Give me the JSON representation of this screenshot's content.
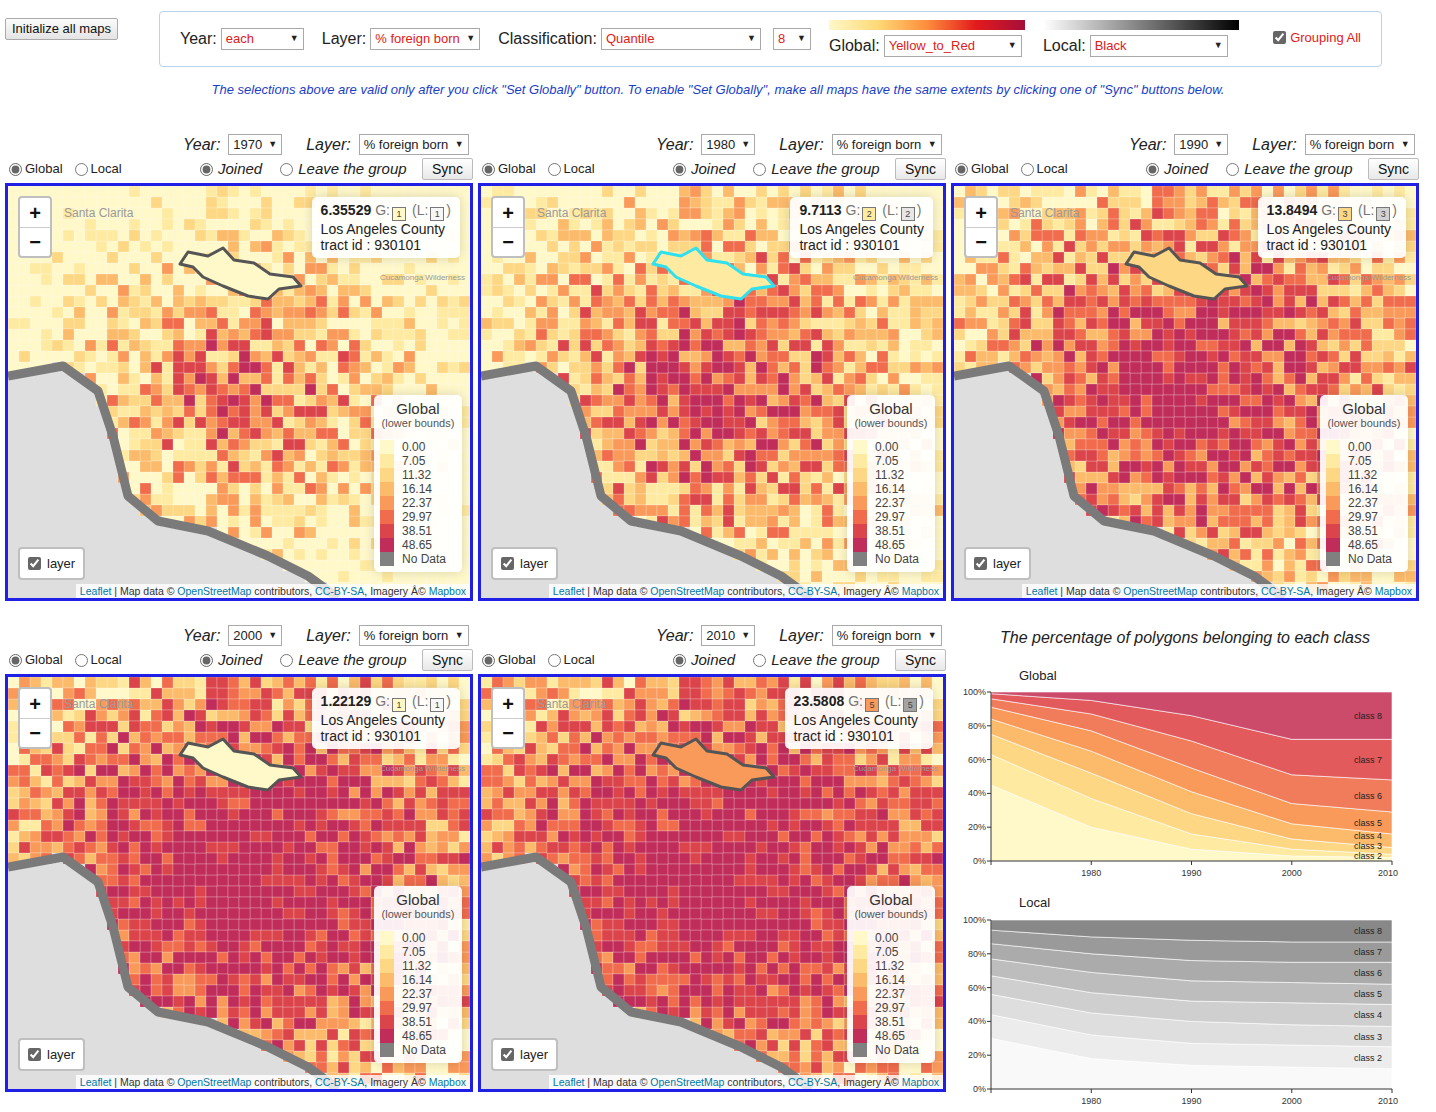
{
  "arrow": "▼",
  "toolbar": {
    "init_button": "Initialize all maps",
    "year": {
      "label": "Year:",
      "value": "each"
    },
    "layer": {
      "label": "Layer:",
      "value": "% foreign born"
    },
    "classification": {
      "label": "Classification:",
      "value": "Quantile"
    },
    "classes": {
      "value": "8"
    },
    "global": {
      "label": "Global:",
      "value": "Yellow_to_Red",
      "ramp": [
        "#fff8c8",
        "#fed976",
        "#fd8d3c",
        "#e31a1c",
        "#a50f3a"
      ]
    },
    "local": {
      "label": "Local:",
      "value": "Black",
      "ramp": [
        "#ffffff",
        "#000000"
      ]
    },
    "grouping": {
      "label": "Grouping All",
      "checked": true
    }
  },
  "note": "The selections above are valid only after you click \"Set Globally\" button. To enable \"Set Globally\", make all maps have the same extents by clicking one of \"Sync\" buttons below.",
  "map_common": {
    "year_label": "Year:",
    "layer_label": "Layer:",
    "zoom_in": "+",
    "zoom_out": "−",
    "place_labels": [
      "Santa Clarita",
      "Cucamonga Wilderness"
    ],
    "legend": {
      "title": "Global",
      "subtitle": "(lower bounds)",
      "items": [
        {
          "label": "0.00",
          "color": "#fff8c8"
        },
        {
          "label": "7.05",
          "color": "#feeaa0"
        },
        {
          "label": "11.32",
          "color": "#fdd783"
        },
        {
          "label": "16.14",
          "color": "#fcbb6b"
        },
        {
          "label": "22.37",
          "color": "#fa9a5a"
        },
        {
          "label": "29.97",
          "color": "#f06c4c"
        },
        {
          "label": "38.51",
          "color": "#db444b"
        },
        {
          "label": "48.65",
          "color": "#c02d5a"
        },
        {
          "label": "No Data",
          "color": "#808080"
        }
      ]
    },
    "attribution": [
      {
        "text": "Leaflet",
        "link": true
      },
      {
        "text": " | Map data © ",
        "link": false
      },
      {
        "text": "OpenStreetMap",
        "link": true
      },
      {
        "text": " contributors, ",
        "link": false
      },
      {
        "text": "CC-BY-SA",
        "link": true
      },
      {
        "text": ", Imagery Â© ",
        "link": false
      },
      {
        "text": "Mapbox",
        "link": true
      }
    ]
  },
  "maps": [
    {
      "year": "1970",
      "layer": "% foreign born",
      "scope": [
        {
          "label": "Global",
          "selected": true
        },
        {
          "label": "Local",
          "selected": false
        }
      ],
      "group": [
        {
          "label": "Joined",
          "selected": true
        },
        {
          "label": "Leave the group",
          "selected": false
        }
      ],
      "sync": "Sync",
      "info": {
        "value": "6.35529",
        "g_label": "G:",
        "g_class": "1",
        "g_color": "#fff8c8",
        "l_label": "(L:",
        "l_class": "1",
        "l_color": "#f7f7f7",
        "l_close": ")",
        "county": "Los Angeles County",
        "tract": "tract id : 930101"
      },
      "tract": {
        "fill": "#fff8c8",
        "outline": "#555555"
      },
      "layer_toggle": {
        "label": "layer",
        "checked": true
      }
    },
    {
      "year": "1980",
      "layer": "% foreign born",
      "scope": [
        {
          "label": "Global",
          "selected": true
        },
        {
          "label": "Local",
          "selected": false
        }
      ],
      "group": [
        {
          "label": "Joined",
          "selected": true
        },
        {
          "label": "Leave the group",
          "selected": false
        }
      ],
      "sync": "Sync",
      "info": {
        "value": "9.7113",
        "g_label": "G:",
        "g_class": "2",
        "g_color": "#feeaa0",
        "l_label": "(L:",
        "l_class": "2",
        "l_color": "#e6e6e6",
        "l_close": ")",
        "county": "Los Angeles County",
        "tract": "tract id : 930101"
      },
      "tract": {
        "fill": "#feeaa0",
        "outline": "#2fe0ee"
      },
      "layer_toggle": {
        "label": "layer",
        "checked": true
      }
    },
    {
      "year": "1990",
      "layer": "% foreign born",
      "scope": [
        {
          "label": "Global",
          "selected": true
        },
        {
          "label": "Local",
          "selected": false
        }
      ],
      "group": [
        {
          "label": "Joined",
          "selected": true
        },
        {
          "label": "Leave the group",
          "selected": false
        }
      ],
      "sync": "Sync",
      "info": {
        "value": "13.8494",
        "g_label": "G:",
        "g_class": "3",
        "g_color": "#fdd783",
        "l_label": "(L:",
        "l_class": "3",
        "l_color": "#d2d2d2",
        "l_close": ")",
        "county": "Los Angeles County",
        "tract": "tract id : 930101"
      },
      "tract": {
        "fill": "#fdd783",
        "outline": "#555555"
      },
      "layer_toggle": {
        "label": "layer",
        "checked": true
      }
    },
    {
      "year": "2000",
      "layer": "% foreign born",
      "scope": [
        {
          "label": "Global",
          "selected": true
        },
        {
          "label": "Local",
          "selected": false
        }
      ],
      "group": [
        {
          "label": "Joined",
          "selected": true
        },
        {
          "label": "Leave the group",
          "selected": false
        }
      ],
      "sync": "Sync",
      "info": {
        "value": "1.22129",
        "g_label": "G:",
        "g_class": "1",
        "g_color": "#fff8c8",
        "l_label": "(L:",
        "l_class": "1",
        "l_color": "#f7f7f7",
        "l_close": ")",
        "county": "Los Angeles County",
        "tract": "tract id : 930101"
      },
      "tract": {
        "fill": "#fff8c8",
        "outline": "#555555"
      },
      "layer_toggle": {
        "label": "layer",
        "checked": true
      }
    },
    {
      "year": "2010",
      "layer": "% foreign born",
      "scope": [
        {
          "label": "Global",
          "selected": true
        },
        {
          "label": "Local",
          "selected": false
        }
      ],
      "group": [
        {
          "label": "Joined",
          "selected": true
        },
        {
          "label": "Leave the group",
          "selected": false
        }
      ],
      "sync": "Sync",
      "info": {
        "value": "23.5808",
        "g_label": "G:",
        "g_class": "5",
        "g_color": "#fa9a5a",
        "l_label": "(L:",
        "l_class": "5",
        "l_color": "#a3a3a3",
        "l_close": ")",
        "county": "Los Angeles County",
        "tract": "tract id : 930101"
      },
      "tract": {
        "fill": "#fa9a5a",
        "outline": "#555555"
      },
      "layer_toggle": {
        "label": "layer",
        "checked": true
      }
    }
  ],
  "chart": {
    "title": "The percentage of polygons belonging to each class",
    "panels": [
      {
        "title": "Global",
        "y_ticks": [
          "0%",
          "20%",
          "40%",
          "60%",
          "80%",
          "100%"
        ],
        "x_ticks": [
          "1980",
          "1990",
          "2000",
          "2010"
        ],
        "series": [
          {
            "label": null,
            "color": "#fff8c8",
            "values": [
              45,
              20,
              7,
              3,
              2
            ]
          },
          {
            "label": "class 2",
            "color": "#feeaa0",
            "values": [
              18,
              17,
              9,
              4,
              2
            ]
          },
          {
            "label": "class 3",
            "color": "#fdd783",
            "values": [
              12,
              15,
              12,
              6,
              4
            ]
          },
          {
            "label": "class 4",
            "color": "#fcbb6b",
            "values": [
              9,
              13,
              13,
              9,
              8
            ]
          },
          {
            "label": "class 5",
            "color": "#fa9a5a",
            "values": [
              7,
              12,
              14,
              12,
              13
            ]
          },
          {
            "label": "class 6",
            "color": "#f07c5c",
            "values": [
              5,
              10,
              16,
              17,
              19
            ]
          },
          {
            "label": "class 7",
            "color": "#e25a5c",
            "values": [
              3,
              8,
              15,
              21,
              24
            ]
          },
          {
            "label": "class 8",
            "color": "#cc4a6a",
            "values": [
              1,
              5,
              14,
              28,
              28
            ]
          }
        ]
      },
      {
        "title": "Local",
        "y_ticks": [
          "0%",
          "20%",
          "40%",
          "60%",
          "80%",
          "100%"
        ],
        "x_ticks": [
          "1980",
          "1990",
          "2000",
          "2010"
        ],
        "series": [
          {
            "label": null,
            "color": "#f9f9f9",
            "values": [
              30,
              18,
              14,
              13,
              12
            ]
          },
          {
            "label": "class 2",
            "color": "#ececec",
            "values": [
              14,
              14,
              13,
              13,
              13
            ]
          },
          {
            "label": "class 3",
            "color": "#dedede",
            "values": [
              12,
              13,
              13,
              12,
              12
            ]
          },
          {
            "label": "class 4",
            "color": "#cfcfcf",
            "values": [
              11,
              12,
              12,
              13,
              13
            ]
          },
          {
            "label": "class 5",
            "color": "#bdbdbd",
            "values": [
              10,
              12,
              12,
              12,
              12
            ]
          },
          {
            "label": "class 6",
            "color": "#ababab",
            "values": [
              9,
              11,
              12,
              12,
              13
            ]
          },
          {
            "label": "class 7",
            "color": "#9a9a9a",
            "values": [
              8,
              10,
              12,
              12,
              12
            ]
          },
          {
            "label": "class 8",
            "color": "#888888",
            "values": [
              6,
              10,
              12,
              13,
              13
            ]
          }
        ]
      }
    ]
  }
}
